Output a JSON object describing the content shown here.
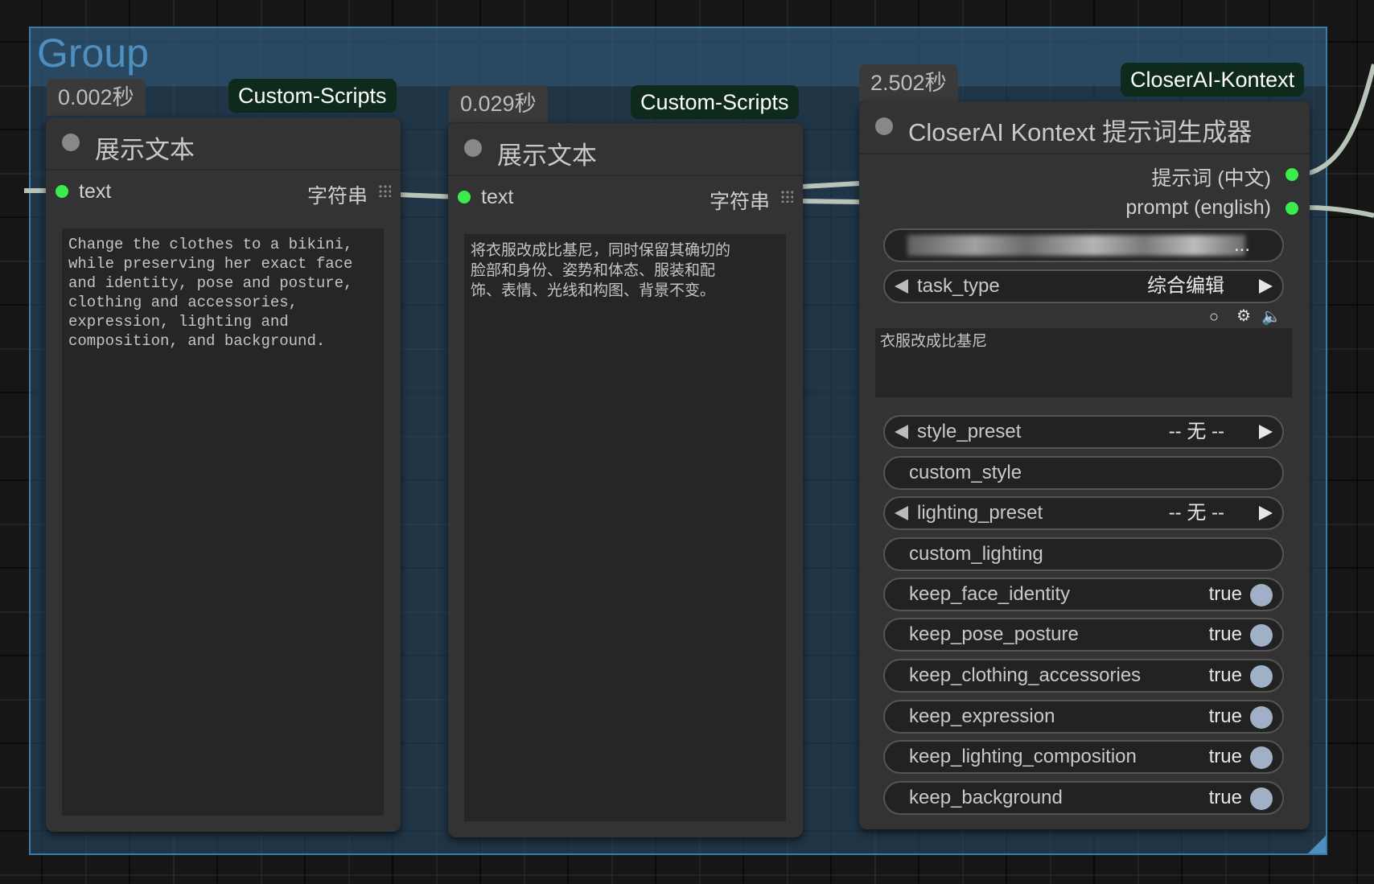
{
  "group": {
    "title": "Group"
  },
  "node1": {
    "timing": "0.002秒",
    "badge": "Custom-Scripts",
    "title": "展示文本",
    "input_label": "text",
    "input_type": "字符串",
    "text": "Change the clothes to a bikini,\nwhile preserving her exact face\nand identity, pose and posture,\nclothing and accessories,\nexpression, lighting and\ncomposition, and background."
  },
  "node2": {
    "timing": "0.029秒",
    "badge": "Custom-Scripts",
    "title": "展示文本",
    "input_label": "text",
    "input_type": "字符串",
    "text": "将衣服改成比基尼，同时保留其确切的\n脸部和身份、姿势和体态、服装和配\n饰、表情、光线和构图、背景不变。"
  },
  "node3": {
    "timing": "2.502秒",
    "badge": "CloserAI-Kontext",
    "title": "CloserAI Kontext 提示词生成器",
    "outputs": [
      "提示词 (中文)",
      "prompt (english)"
    ],
    "api_key_suffix": "...",
    "task_type": {
      "label": "task_type",
      "value": "综合编辑"
    },
    "prompt_text": "衣服改成比基尼",
    "style_preset": {
      "label": "style_preset",
      "value": "-- 无 --"
    },
    "custom_style": "custom_style",
    "lighting_preset": {
      "label": "lighting_preset",
      "value": "-- 无 --"
    },
    "custom_lighting": "custom_lighting",
    "toggles": [
      {
        "label": "keep_face_identity",
        "value": "true"
      },
      {
        "label": "keep_pose_posture",
        "value": "true"
      },
      {
        "label": "keep_clothing_accessories",
        "value": "true"
      },
      {
        "label": "keep_expression",
        "value": "true"
      },
      {
        "label": "keep_lighting_composition",
        "value": "true"
      },
      {
        "label": "keep_background",
        "value": "true"
      }
    ]
  },
  "colors": {
    "slot_connected": "#3cec4c",
    "group_fill": "#2c5273",
    "group_title": "#4f8fc0",
    "badge_bg": "#0e2a1c",
    "toggle_on": "#9fb0c7"
  }
}
